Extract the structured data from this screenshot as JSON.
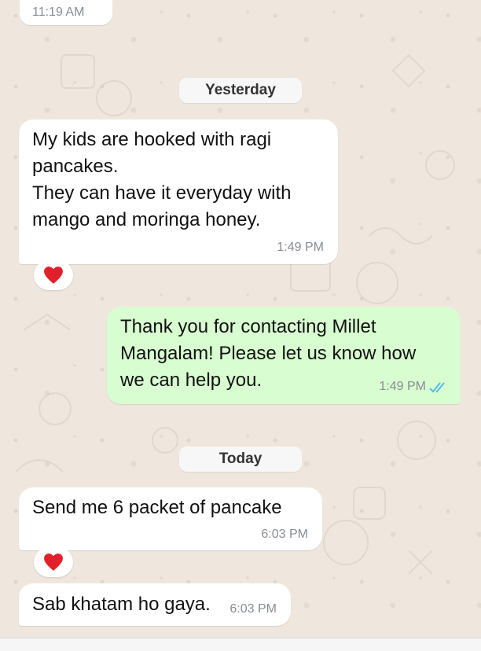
{
  "top_partial": {
    "time": "11:19 AM"
  },
  "date_yesterday": {
    "label": "Yesterday"
  },
  "msg1": {
    "lines": [
      "My kids are hooked with ragi",
      "pancakes.",
      "They can have it everyday with",
      "mango and moringa honey."
    ],
    "time": "1:49 PM",
    "reaction": "heart"
  },
  "msg2": {
    "lines": [
      "Thank you for contacting Millet",
      "Mangalam! Please let us know how",
      "we can help you."
    ],
    "time": "1:49 PM",
    "status": "read"
  },
  "date_today": {
    "label": "Today"
  },
  "msg3": {
    "text": "Send me 6 packet of pancake",
    "time": "6:03 PM",
    "reaction": "heart"
  },
  "msg4": {
    "text": "Sab khatam ho gaya.",
    "time": "6:03 PM"
  },
  "colors": {
    "wallpaper": "#efe7de",
    "incoming_bubble": "#ffffff",
    "outgoing_bubble": "#d8fdd0",
    "read_ticks": "#53bdeb",
    "heart": "#e0202a"
  }
}
